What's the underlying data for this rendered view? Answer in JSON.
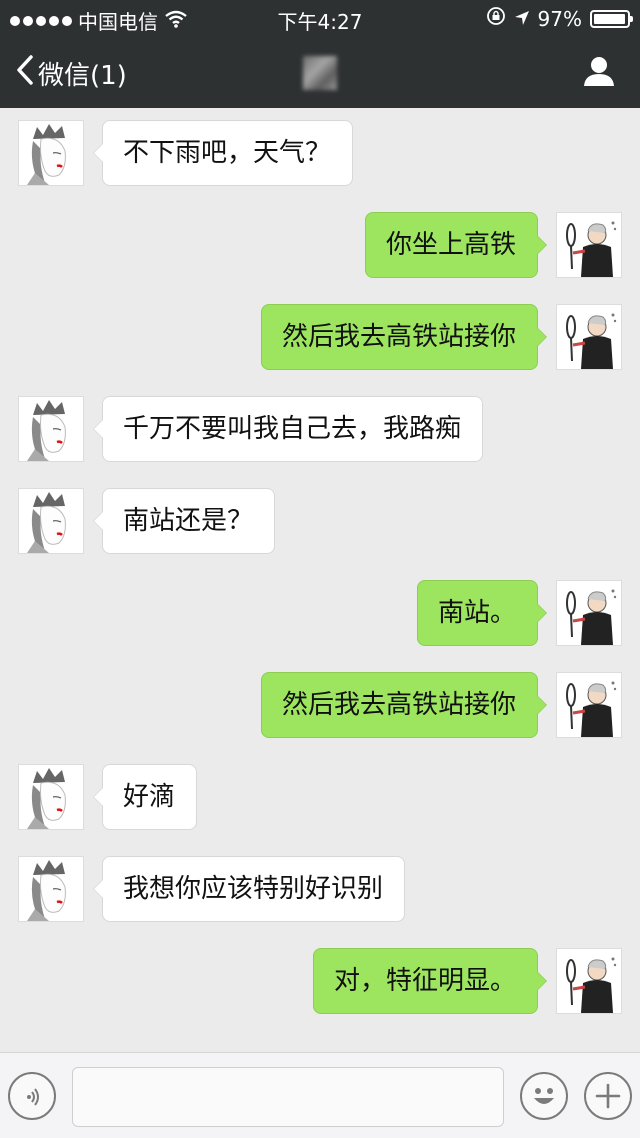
{
  "statusbar": {
    "carrier": "中国电信",
    "time": "下午4:27",
    "battery": "97%"
  },
  "navbar": {
    "back_label": "微信(1)"
  },
  "messages": [
    {
      "side": "left",
      "text": "不下雨吧，天气？"
    },
    {
      "side": "right",
      "text": "你坐上高铁"
    },
    {
      "side": "right",
      "text": "然后我去高铁站接你"
    },
    {
      "side": "left",
      "text": "千万不要叫我自己去，我路痴"
    },
    {
      "side": "left",
      "text": "南站还是？"
    },
    {
      "side": "right",
      "text": "南站。"
    },
    {
      "side": "right",
      "text": "然后我去高铁站接你"
    },
    {
      "side": "left",
      "text": "好滴"
    },
    {
      "side": "left",
      "text": "我想你应该特别好识别"
    },
    {
      "side": "right",
      "text": "对，特征明显。"
    }
  ],
  "inputbar": {
    "value": "",
    "placeholder": ""
  },
  "colors": {
    "bar": "#2e3132",
    "chat_bg": "#ebebeb",
    "bubble_sent": "#9de55f",
    "bubble_received": "#ffffff"
  },
  "icons": {
    "back": "chevron-left-icon",
    "profile": "person-icon",
    "voice": "voice-icon",
    "emoji": "emoji-icon",
    "more": "plus-icon"
  }
}
